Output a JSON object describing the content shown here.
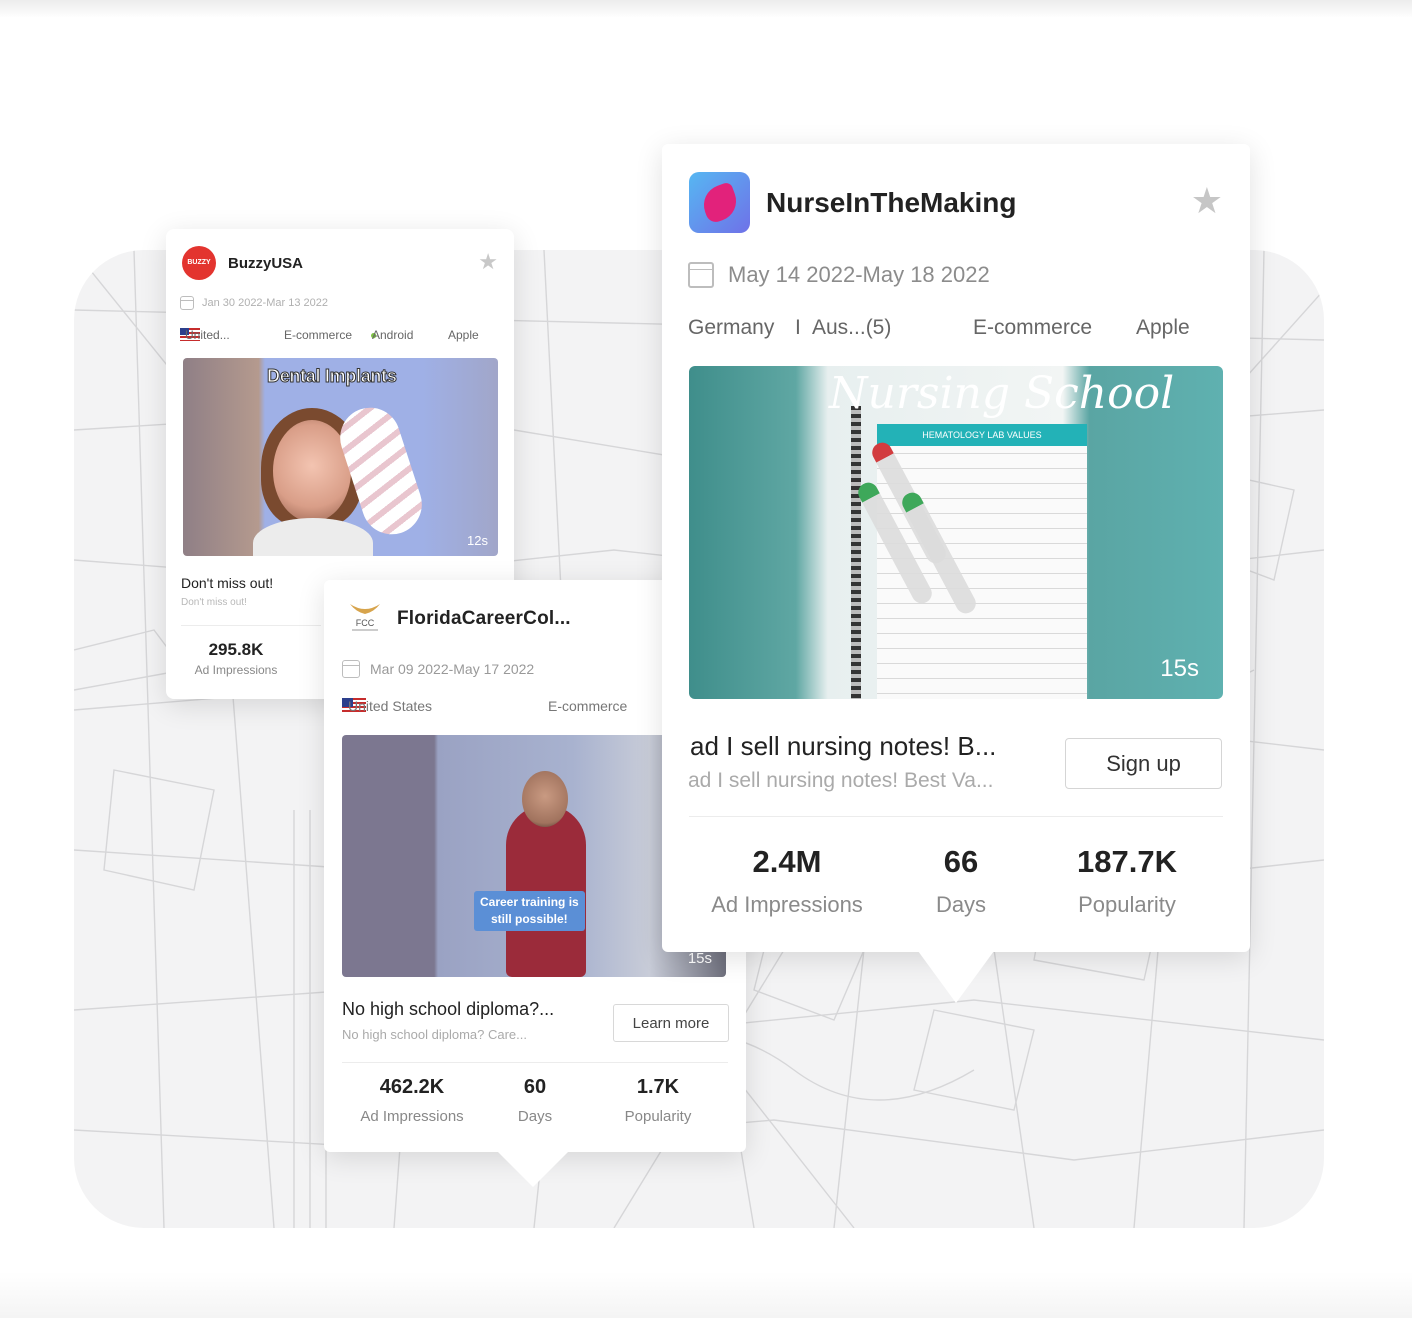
{
  "cards": {
    "buzzy": {
      "logo_text": "BUZZY USA",
      "advertiser": "BuzzyUSA",
      "date_range": "Jan 30 2022-Mar 13 2022",
      "country": "United...",
      "category": "E-commerce",
      "platform_1": "Android",
      "platform_2": "Apple",
      "thumbnail_overlay": "Dental Implants",
      "duration": "12s",
      "headline": "Don't miss out!",
      "subtext": "Don't miss out!",
      "stats": {
        "impressions_value": "295.8K",
        "impressions_label": "Ad Impressions"
      }
    },
    "fcc": {
      "logo_text": "FCC",
      "advertiser": "FloridaCareerCol...",
      "date_range": "Mar 09 2022-May 17 2022",
      "country": "United States",
      "category": "E-commerce",
      "thumbnail_caption_1": "Career training is",
      "thumbnail_caption_2": "still possible!",
      "duration": "15s",
      "headline": "No high school diploma?...",
      "subtext": "No high school diploma? Care...",
      "cta": "Learn more",
      "stats": [
        {
          "value": "462.2K",
          "label": "Ad Impressions"
        },
        {
          "value": "60",
          "label": "Days"
        },
        {
          "value": "1.7K",
          "label": "Popularity"
        }
      ]
    },
    "nurse": {
      "advertiser": "NurseInTheMaking",
      "date_range": "May 14 2022-May 18 2022",
      "country_1": "Germany",
      "separator": "I",
      "country_2": "Aus...(5)",
      "category": "E-commerce",
      "platform": "Apple",
      "thumbnail_title": "Nursing School",
      "thumbnail_sheet_header": "HEMATOLOGY LAB VALUES",
      "duration": "15s",
      "headline": "ad I sell nursing notes! B...",
      "subtext": "ad I sell nursing notes! Best Va...",
      "cta": "Sign up",
      "stats": [
        {
          "value": "2.4M",
          "label": "Ad Impressions"
        },
        {
          "value": "66",
          "label": "Days"
        },
        {
          "value": "187.7K",
          "label": "Popularity"
        }
      ]
    }
  },
  "icons": {
    "favorite": "star-icon",
    "date": "calendar-icon",
    "country": "us-flag-icon",
    "android": "android-icon",
    "apple": "apple-icon"
  },
  "colors": {
    "buzzy_brand": "#e3342f",
    "nurse_logo_gradient_start": "#56b7f2",
    "nurse_logo_gradient_end": "#6f71e8",
    "star_inactive": "#c6c6c6"
  }
}
